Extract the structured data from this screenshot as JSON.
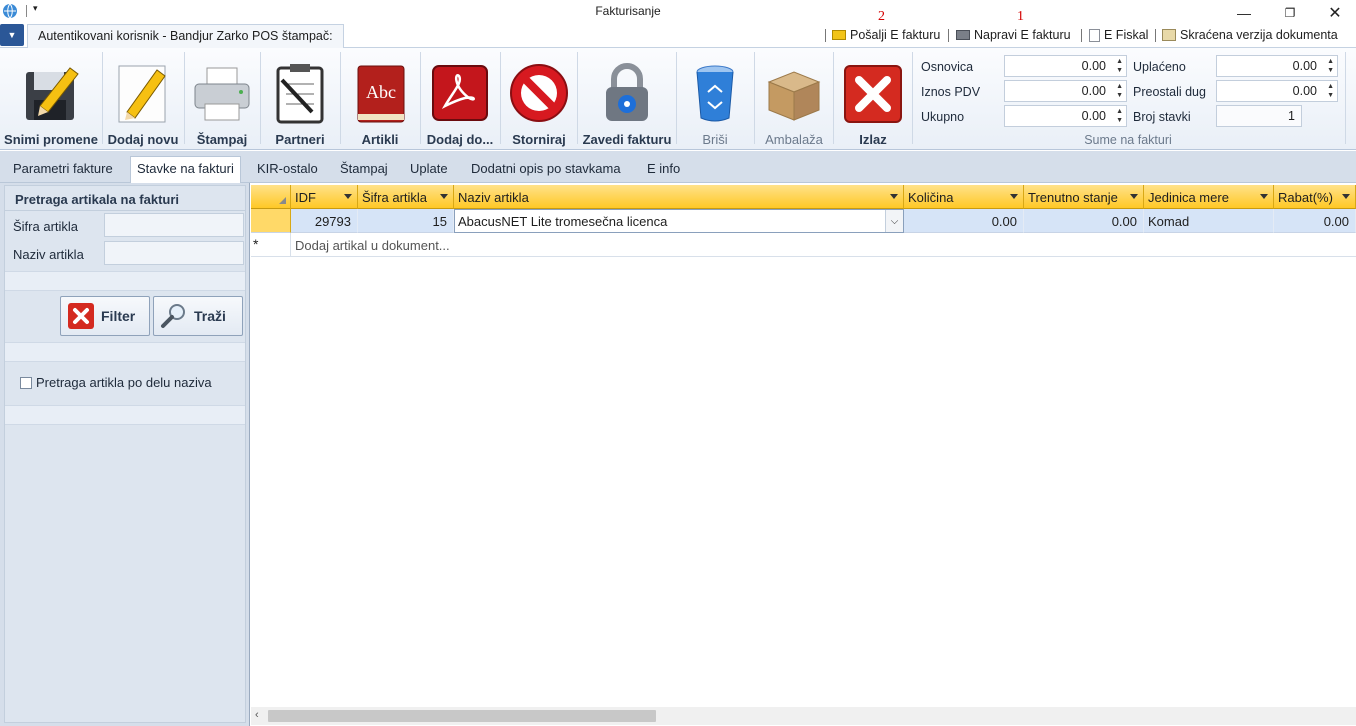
{
  "window": {
    "title": "Fakturisanje"
  },
  "ribbon_header": {
    "tab_label": "Autentikovani korisnik - Bandjur Zarko POS štampač:",
    "links": {
      "posalji": "Pošalji E fakturu",
      "napravi": "Napravi E fakturu",
      "efiskal": "E Fiskal",
      "skracena": "Skraćena verzija dokumenta"
    },
    "annotations": {
      "posalji": "2",
      "napravi": "1"
    }
  },
  "ribbon": {
    "buttons": {
      "snimi": "Snimi promene",
      "dodaj_novu": "Dodaj novu",
      "stampaj": "Štampaj",
      "partneri": "Partneri",
      "artikli": "Artikli",
      "dodaj_do": "Dodaj do...",
      "storniraj": "Storniraj",
      "zavedi": "Zavedi fakturu",
      "brisi": "Briši",
      "ambalaza": "Ambalaža",
      "izlaz": "Izlaz"
    },
    "sums": {
      "caption": "Sume na fakturi",
      "osnovica_label": "Osnovica",
      "osnovica": "0.00",
      "iznos_pdv_label": "Iznos PDV",
      "iznos_pdv": "0.00",
      "ukupno_label": "Ukupno",
      "ukupno": "0.00",
      "uplaceno_label": "Uplaćeno",
      "uplaceno": "0.00",
      "preostali_label": "Preostali dug",
      "preostali": "0.00",
      "broj_stavki_label": "Broj stavki",
      "broj_stavki": "1"
    }
  },
  "tabs": [
    "Parametri fakture",
    "Stavke na fakturi",
    "KIR-ostalo",
    "Štampaj",
    "Uplate",
    "Dodatni opis po stavkama",
    "E info"
  ],
  "left_panel": {
    "header": "Pretraga artikala na fakturi",
    "sifra_label": "Šifra artikla",
    "naziv_label": "Naziv artikla",
    "filter_button": "Filter",
    "trazi_button": "Traži",
    "partial_search_label": "Pretraga artikla po delu naziva"
  },
  "grid": {
    "columns": [
      "IDF",
      "Šifra artikla",
      "Naziv artikla",
      "Količina",
      "Trenutno stanje",
      "Jedinica mere",
      "Rabat(%)"
    ],
    "rows": [
      {
        "idf": "29793",
        "sifra": "15",
        "naziv": "AbacusNET Lite tromesečna licenca",
        "kolicina": "0.00",
        "stanje": "0.00",
        "jedinica": "Komad",
        "rabat": "0.00"
      }
    ],
    "new_row_placeholder": "Dodaj artikal u dokument...",
    "new_row_marker": "*"
  },
  "colors": {
    "header_yellow": "#ffc826",
    "selected_row": "#d6e4f7",
    "annotation_red": "#d40000"
  }
}
